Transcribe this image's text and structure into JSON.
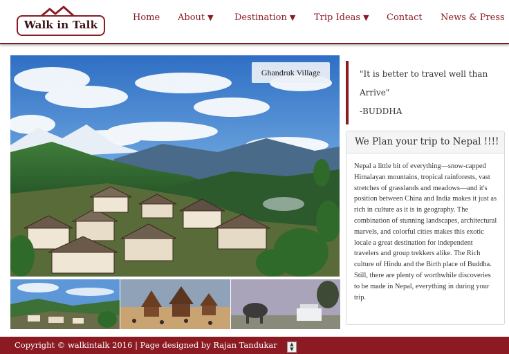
{
  "brand": {
    "logo_text": "Walk in Talk"
  },
  "nav": {
    "items": [
      {
        "label": "Home",
        "caret": ""
      },
      {
        "label": "About",
        "caret": "▼"
      },
      {
        "label": "Destination",
        "caret": "▼"
      },
      {
        "label": "Trip Ideas",
        "caret": "▼"
      },
      {
        "label": "Contact",
        "caret": ""
      },
      {
        "label": "News & Press",
        "caret": ""
      }
    ]
  },
  "hero": {
    "caption": "Ghandruk Village"
  },
  "quote": {
    "line1": "\"It is better to travel well than",
    "line2": "Arrive\"",
    "author": "-BUDDHA"
  },
  "panel": {
    "title": "We Plan your trip to Nepal !!!!",
    "body": "Nepal a little bit of everything—snow-capped Himalayan mountains, tropical rainforests, vast stretches of grasslands and meadows—and it's position between China and India makes it just as rich in culture as it is in geography. The combination of stunning landscapes, architectural marvels, and colorful cities makes this exotic locale a great destination for independent travelers and group trekkers alike. The Rich culture of Hindu and the Birth place of Buddha. Still, there are plenty of worthwhile discoveries to be made in Nepal, everything in during your trip."
  },
  "footer": {
    "text": "Copyright © walkintalk 2016  |  Page designed by Rajan Tandukar"
  },
  "colors": {
    "brand": "#8b1a22",
    "footer_bg": "#8b1a22",
    "nav_text": "#8b1a22"
  },
  "icons": {
    "nav_caret": "chevron-down-icon",
    "scroll": "scroll-arrows-icon"
  }
}
